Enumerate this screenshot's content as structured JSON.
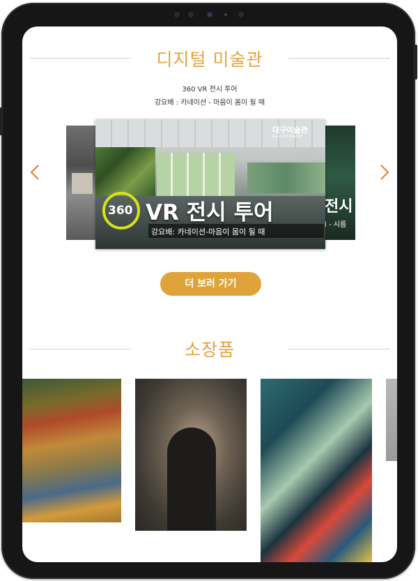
{
  "colors": {
    "accent": "#e3a33c",
    "button": "#dea43a",
    "bezel": "#161616"
  },
  "digital_museum": {
    "title": "디지털 미술관",
    "line1": "360 VR 전시 투어",
    "line2": "강요배 : 카네이션 - 마음이 몸이 될 때",
    "prev_icon": "chevron-left-icon",
    "next_icon": "chevron-right-icon",
    "main_slide": {
      "logo": "대구미술관",
      "logo_sub": "DAEGU ART MUSEUM",
      "badge": "360",
      "headline": "VR 전시 투어",
      "caption": "강요배: 카네이션-마음이 몸이 될 때"
    },
    "right_slide": {
      "text1": "전시",
      "text2": "l - 시름"
    },
    "more_button": "더 보러 가기"
  },
  "collection": {
    "title": "소장품"
  }
}
